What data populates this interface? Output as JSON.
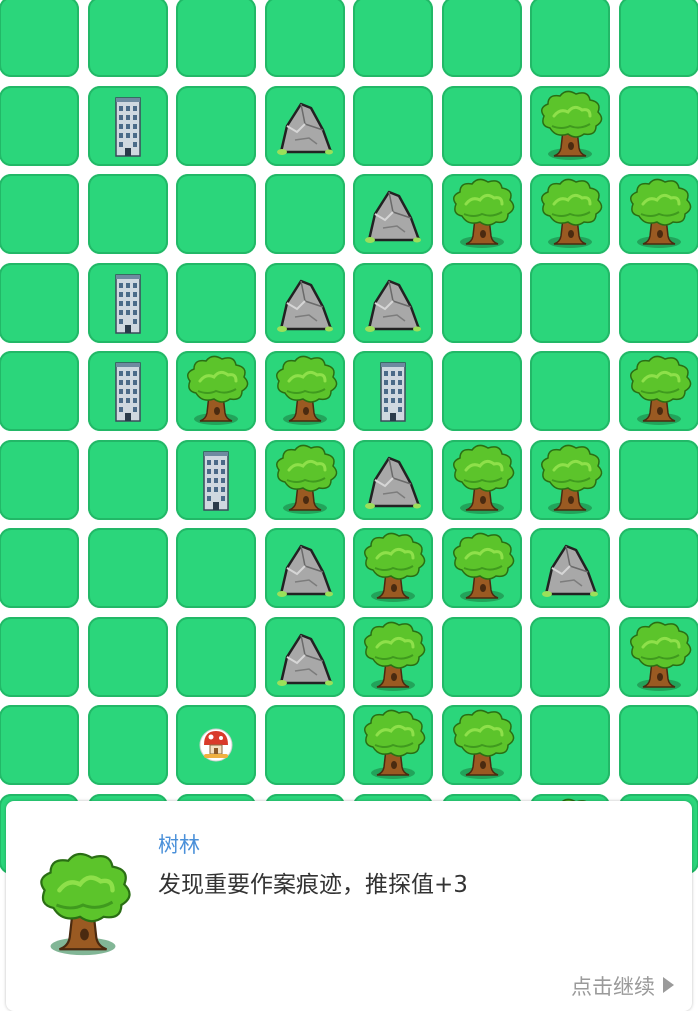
{
  "board": {
    "rows": [
      [
        "grass",
        "grass",
        "grass",
        "grass",
        "grass",
        "grass",
        "grass",
        "grass"
      ],
      [
        "grass",
        "building",
        "grass",
        "rock",
        "grass",
        "grass",
        "tree",
        "grass"
      ],
      [
        "grass",
        "grass",
        "grass",
        "grass",
        "rock",
        "tree",
        "tree",
        "tree"
      ],
      [
        "grass",
        "building",
        "grass",
        "rock",
        "rock",
        "grass",
        "grass",
        "grass"
      ],
      [
        "grass",
        "building",
        "tree",
        "tree",
        "building",
        "grass",
        "grass",
        "tree"
      ],
      [
        "grass",
        "grass",
        "building",
        "tree",
        "rock",
        "tree",
        "tree",
        "grass"
      ],
      [
        "grass",
        "grass",
        "grass",
        "rock",
        "tree",
        "tree",
        "rock",
        "grass"
      ],
      [
        "grass",
        "grass",
        "grass",
        "rock",
        "tree",
        "grass",
        "grass",
        "tree"
      ],
      [
        "grass",
        "grass",
        "player",
        "grass",
        "tree",
        "tree",
        "grass",
        "grass"
      ],
      [
        "grass",
        "grass",
        "grass",
        "grass",
        "grass",
        "grass",
        "tree",
        "grass"
      ]
    ],
    "colors": {
      "tile": "#2bd67b",
      "tile_border": "#22b867"
    }
  },
  "dialog": {
    "icon": "tree-icon",
    "title": "树林",
    "message": "发现重要作案痕迹，推探值+3",
    "continue_label": "点击继续",
    "continue_icon": "play-arrow-icon",
    "colors": {
      "title": "#4a90d9",
      "message": "#333333",
      "continue": "#9a9a9a"
    }
  }
}
